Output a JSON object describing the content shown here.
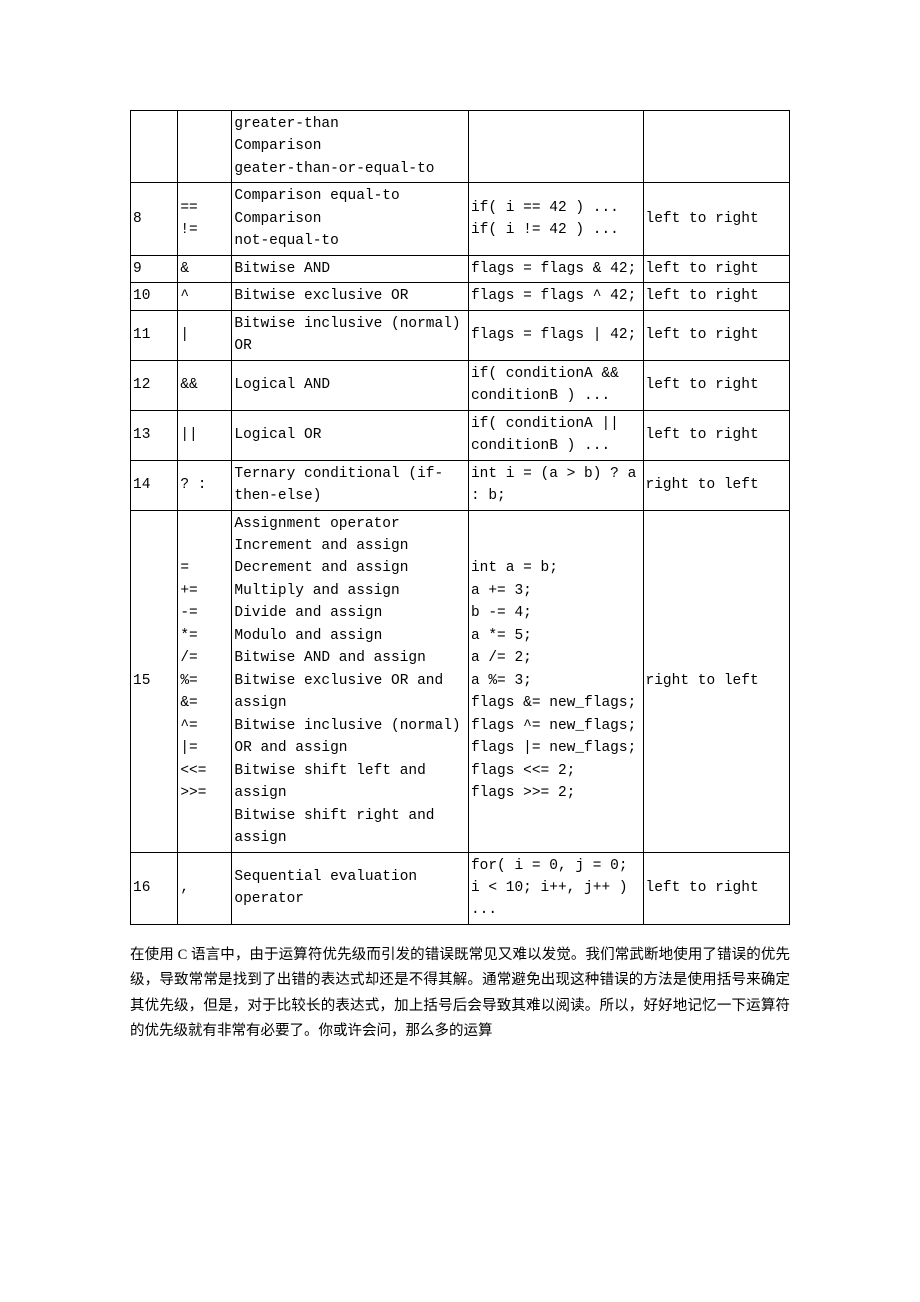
{
  "table": {
    "rows": [
      {
        "precedence": "",
        "operator": "",
        "description": "greater-than\nComparison\ngeater-than-or-equal-to",
        "example": "",
        "associativity": ""
      },
      {
        "precedence": "8",
        "operator": "==\n!=",
        "description": "Comparison equal-to\nComparison\nnot-equal-to",
        "example": "if( i == 42 ) ...\nif( i != 42 ) ...",
        "associativity": "left to right"
      },
      {
        "precedence": "9",
        "operator": "&",
        "description": "Bitwise AND",
        "example": "flags = flags & 42;",
        "associativity": "left to right"
      },
      {
        "precedence": "10",
        "operator": "^",
        "description": "Bitwise exclusive OR",
        "example": "flags = flags ^ 42;",
        "associativity": "left to right"
      },
      {
        "precedence": "11",
        "operator": "|",
        "description": "Bitwise inclusive (normal) OR",
        "example": "flags = flags | 42;",
        "associativity": "left to right"
      },
      {
        "precedence": "12",
        "operator": "&&",
        "description": "Logical AND",
        "example": "if( conditionA && conditionB ) ...",
        "associativity": "left to right"
      },
      {
        "precedence": "13",
        "operator": "||",
        "description": "Logical OR",
        "example": "if( conditionA || conditionB ) ...",
        "associativity": "left to right"
      },
      {
        "precedence": "14",
        "operator": "? :",
        "description": "Ternary conditional (if-then-else)",
        "example": "int i = (a > b) ? a : b;",
        "associativity": "right to left"
      },
      {
        "precedence": "15",
        "operator": "=\n+=\n-=\n*=\n/=\n%=\n&=\n^=\n|=\n<<=\n>>=",
        "description": "Assignment operator\nIncrement and assign\nDecrement and assign\nMultiply and assign\nDivide and assign\nModulo and assign\nBitwise AND and assign\nBitwise exclusive OR and assign\nBitwise inclusive (normal) OR and assign\nBitwise shift left and assign\nBitwise shift right and assign",
        "example": "int a = b;\na += 3;\nb -= 4;\na *= 5;\na /= 2;\na %= 3;\nflags &= new_flags;\nflags ^= new_flags;\nflags |= new_flags;\nflags <<= 2;\nflags >>= 2;",
        "associativity": "right to left"
      },
      {
        "precedence": "16",
        "operator": ",",
        "description": "Sequential evaluation operator",
        "example": "for( i = 0, j = 0; i < 10; i++, j++ ) ...",
        "associativity": "left to right"
      }
    ]
  },
  "paragraph": "在使用 C 语言中，由于运算符优先级而引发的错误既常见又难以发觉。我们常武断地使用了错误的优先级，导致常常是找到了出错的表达式却还是不得其解。通常避免出现这种错误的方法是使用括号来确定其优先级，但是，对于比较长的表达式，加上括号后会导致其难以阅读。所以，好好地记忆一下运算符的优先级就有非常有必要了。你或许会问，那么多的运算"
}
